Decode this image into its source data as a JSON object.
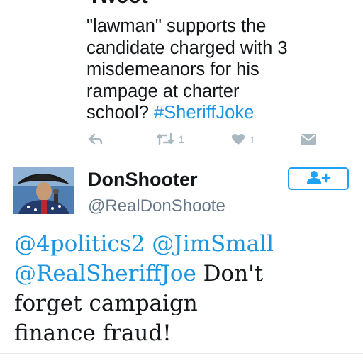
{
  "top_heading": "Tweet",
  "tweet_above": {
    "text_lines": [
      "\"lawman\" supports the",
      "candidate charged with 3",
      "misdemeanors for his",
      "rampage at charter"
    ],
    "last_line_prefix": "school? ",
    "hashtag": "#SheriffJoke",
    "retweet_count": "1",
    "like_count": "1",
    "icons": [
      "reply-icon",
      "retweet-icon",
      "heart-icon",
      "message-icon"
    ]
  },
  "tweet": {
    "display_name": "DonShooter",
    "handle": "@RealDonShoote",
    "follow_icon": "add-user-icon",
    "mentions_line1": [
      "@4politics2",
      "@JimSmall"
    ],
    "mention_line2": "@RealSheriffJoe",
    "text_after_mention": " Don't",
    "text_lines": [
      "forget campaign",
      "finance fraud!"
    ]
  },
  "colors": {
    "link": "#1b95e0",
    "follow_border": "#1da1f2",
    "icon_gray": "#aab8c2",
    "handle_gray": "#657786",
    "text": "#14171a"
  }
}
